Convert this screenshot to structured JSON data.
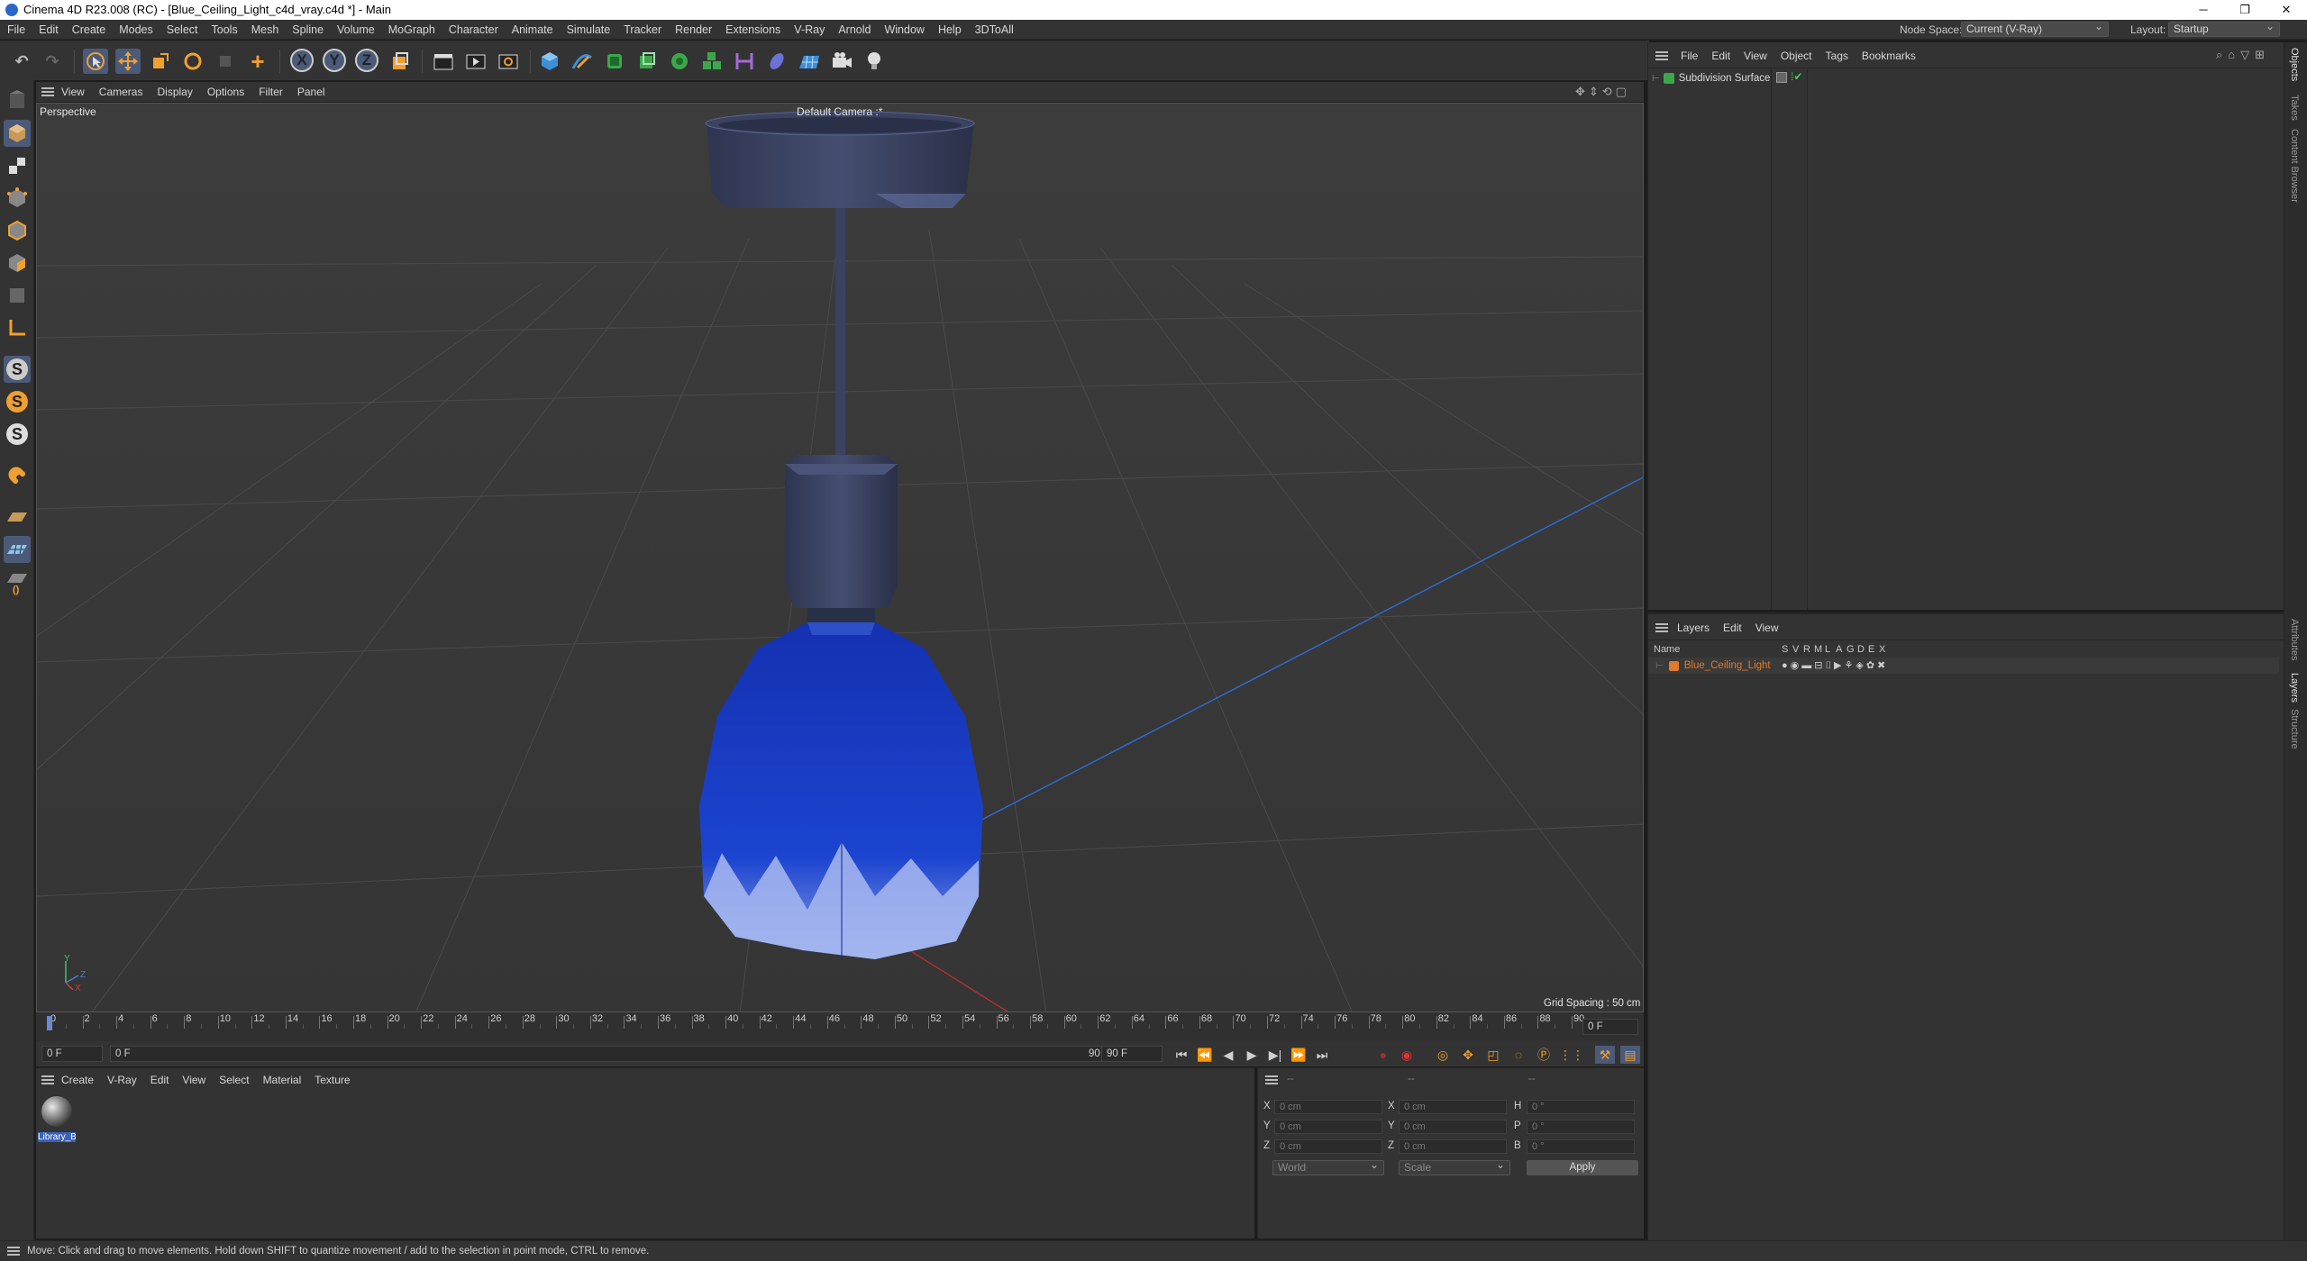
{
  "window": {
    "title": "Cinema 4D R23.008 (RC) - [Blue_Ceiling_Light_c4d_vray.c4d *] - Main",
    "minimize": "─",
    "maximize": "❐",
    "close": "✕"
  },
  "menubar": {
    "items": [
      "File",
      "Edit",
      "Create",
      "Modes",
      "Select",
      "Tools",
      "Mesh",
      "Spline",
      "Volume",
      "MoGraph",
      "Character",
      "Animate",
      "Simulate",
      "Tracker",
      "Render",
      "Extensions",
      "V-Ray",
      "Arnold",
      "Window",
      "Help",
      "3DToAll"
    ],
    "node_space_label": "Node Space:",
    "node_space_value": "Current (V-Ray)",
    "layout_label": "Layout:",
    "layout_value": "Startup"
  },
  "toolbar": {
    "x_axis": "X",
    "y_axis": "Y",
    "z_axis": "Z"
  },
  "lefttoolbar": {
    "s1": "S",
    "s2": "S",
    "s3": "S"
  },
  "viewport": {
    "menu": [
      "View",
      "Cameras",
      "Display",
      "Options",
      "Filter",
      "Panel"
    ],
    "projection": "Perspective",
    "camera": "Default Camera :*",
    "grid_spacing": "Grid Spacing : 50 cm",
    "axis_y": "Y",
    "axis_z": "Z",
    "axis_x": "X"
  },
  "timeline": {
    "ticks": [
      "0",
      "2",
      "4",
      "6",
      "8",
      "10",
      "12",
      "14",
      "16",
      "18",
      "20",
      "22",
      "24",
      "26",
      "28",
      "30",
      "32",
      "34",
      "36",
      "38",
      "40",
      "42",
      "44",
      "46",
      "48",
      "50",
      "52",
      "54",
      "56",
      "58",
      "60",
      "62",
      "64",
      "66",
      "68",
      "70",
      "72",
      "74",
      "76",
      "78",
      "80",
      "82",
      "84",
      "86",
      "88",
      "90"
    ],
    "current_frame": "0 F",
    "start_frame": "0 F",
    "range_start": "0 F",
    "range_end": "90 F",
    "end_frame": "90 F"
  },
  "material_manager": {
    "menu": [
      "Create",
      "V-Ray",
      "Edit",
      "View",
      "Select",
      "Material",
      "Texture"
    ],
    "material_name": "Library_B"
  },
  "coordinates": {
    "header_left": "--",
    "header_mid": "--",
    "header_right": "--",
    "rows": [
      {
        "pos_label": "X",
        "pos_value": "0 cm",
        "size_label": "X",
        "size_value": "0 cm",
        "rot_label": "H",
        "rot_value": "0 °"
      },
      {
        "pos_label": "Y",
        "pos_value": "0 cm",
        "size_label": "Y",
        "size_value": "0 cm",
        "rot_label": "P",
        "rot_value": "0 °"
      },
      {
        "pos_label": "Z",
        "pos_value": "0 cm",
        "size_label": "Z",
        "size_value": "0 cm",
        "rot_label": "B",
        "rot_value": "0 °"
      }
    ],
    "space_value": "World",
    "mode_value": "Scale",
    "apply_label": "Apply"
  },
  "object_manager": {
    "menu": [
      "File",
      "Edit",
      "View",
      "Object",
      "Tags",
      "Bookmarks"
    ],
    "object_name": "Subdivision Surface"
  },
  "layer_manager": {
    "menu": [
      "Layers",
      "Edit",
      "View"
    ],
    "name_header": "Name",
    "column_headers": [
      "S",
      "V",
      "R",
      "M",
      "L",
      "A",
      "G",
      "D",
      "E",
      "X"
    ],
    "layer_name": "Blue_Ceiling_Light",
    "layer_color": "#e07a2a"
  },
  "side_tabs": {
    "objects": "Objects",
    "takes": "Takes",
    "content_browser": "Content Browser",
    "attributes": "Attributes",
    "layers": "Layers",
    "structure": "Structure"
  },
  "status": {
    "message": "Move: Click and drag to move elements. Hold down SHIFT to quantize movement / add to the selection in point mode, CTRL to remove."
  },
  "colors": {
    "ui_dark": "#333333",
    "viewport_bg": "#3a3a3a",
    "accent_blue": "#9ab4e0",
    "shade_blue": "#1a3fc0",
    "metal_dark": "#3a4260"
  }
}
